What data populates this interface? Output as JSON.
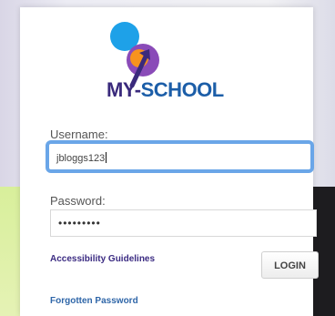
{
  "brand": {
    "logo_text_my": "MY-",
    "logo_text_school": "SCHOOL",
    "colors": {
      "navy": "#3a2a7c",
      "blue": "#1c5ea8",
      "light_blue": "#1ea1e8",
      "orange": "#f7931e",
      "purple": "#8a4bb8"
    }
  },
  "form": {
    "username_label": "Username:",
    "username_value": "jbloggs123",
    "password_label": "Password:",
    "password_value": "•••••••••",
    "login_label": "LOGIN"
  },
  "links": {
    "accessibility": "Accessibility Guidelines",
    "forgotten_password": "Forgotten Password"
  }
}
